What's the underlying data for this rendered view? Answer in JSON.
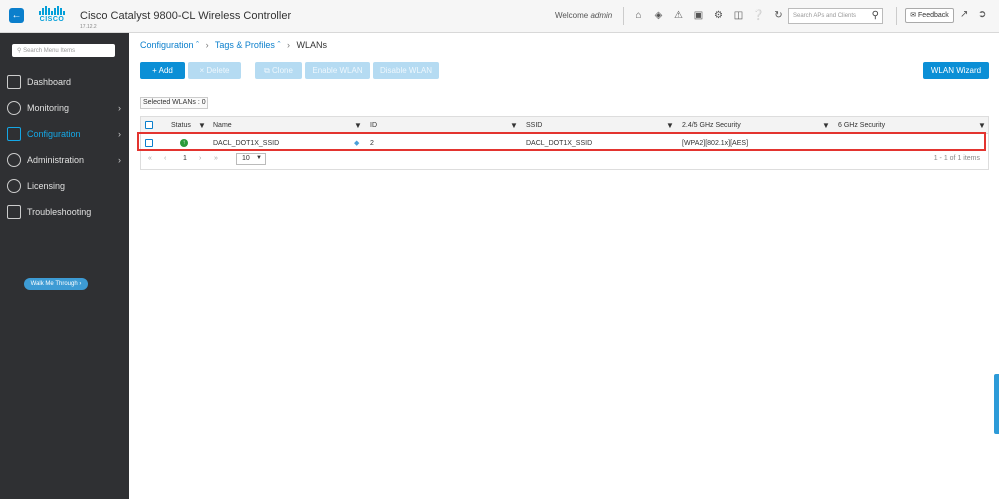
{
  "header": {
    "back_icon": "back-arrow-icon",
    "logo_text": "CISCO",
    "title": "Cisco Catalyst 9800-CL Wireless Controller",
    "version": "17.12.2",
    "welcome_prefix": "Welcome",
    "welcome_user": "admin",
    "icons": [
      "home-icon",
      "wireless-icon",
      "alert-icon",
      "save-icon",
      "settings-icon",
      "clipboard-icon",
      "help-icon",
      "refresh-icon"
    ],
    "search_placeholder": "Search APs and Clients",
    "feedback_label": "Feedback"
  },
  "sidebar": {
    "search_placeholder": "Search Menu Items",
    "items": [
      {
        "label": "Dashboard",
        "icon": "dashboard-icon",
        "has_chevron": false
      },
      {
        "label": "Monitoring",
        "icon": "monitoring-icon",
        "has_chevron": true
      },
      {
        "label": "Configuration",
        "icon": "configuration-icon",
        "has_chevron": true,
        "active": true
      },
      {
        "label": "Administration",
        "icon": "administration-icon",
        "has_chevron": true
      },
      {
        "label": "Licensing",
        "icon": "licensing-icon",
        "has_chevron": false
      },
      {
        "label": "Troubleshooting",
        "icon": "troubleshooting-icon",
        "has_chevron": false
      }
    ],
    "walk_me_label": "Walk Me Through ›"
  },
  "breadcrumb": {
    "item1": "Configuration",
    "item2": "Tags & Profiles",
    "current": "WLANs"
  },
  "toolbar": {
    "add_label": "+ Add",
    "delete_label": "× Delete",
    "clone_label": "Clone",
    "enable_label": "Enable WLAN",
    "disable_label": "Disable WLAN",
    "wizard_label": "WLAN Wizard"
  },
  "selected_label": "Selected WLANs : 0",
  "table": {
    "columns": [
      "Status",
      "Name",
      "ID",
      "SSID",
      "2.4/5 GHz Security",
      "6 GHz Security"
    ],
    "rows": [
      {
        "status": "up",
        "name": "DACL_DOT1X_SSID",
        "id": "2",
        "ssid": "DACL_DOT1X_SSID",
        "security_24_5": "[WPA2][802.1x][AES]",
        "security_6": ""
      }
    ],
    "pager": {
      "page": "1",
      "page_size": "10",
      "items_text": "1 - 1 of 1 items"
    }
  },
  "colors": {
    "accent": "#0b8fd6",
    "highlight": "#e3342f",
    "sidebar_bg": "#2f3033",
    "active_menu": "#15a7e6"
  }
}
